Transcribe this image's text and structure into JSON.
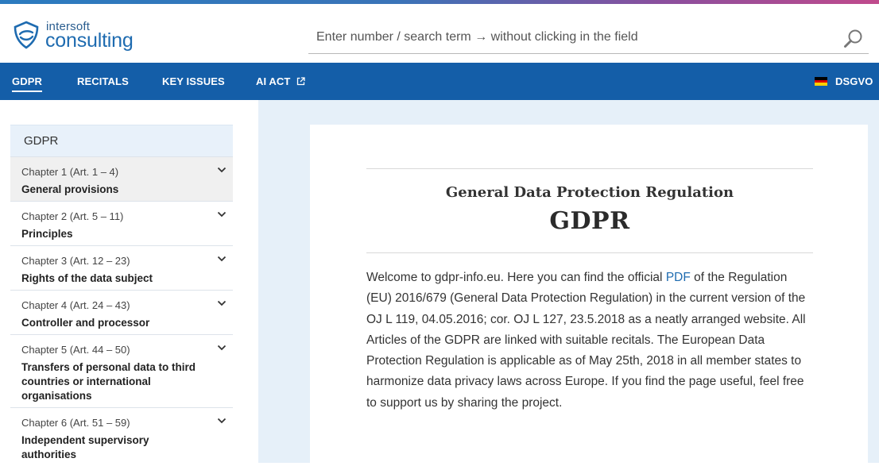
{
  "brand": {
    "line1": "intersoft",
    "line2": "consulting",
    "color": "#1e6bb0"
  },
  "search": {
    "placeholder": "Enter number / search term → without clicking in the field",
    "icon": "magnifier-icon"
  },
  "nav": {
    "items": [
      {
        "label": "GDPR",
        "active": true
      },
      {
        "label": "RECITALS"
      },
      {
        "label": "KEY ISSUES"
      },
      {
        "label": "AI ACT",
        "icon": "external-link-icon"
      }
    ],
    "lang_label": "DSGVO",
    "lang_icon": "german-flag-icon",
    "bg": "#145ea8"
  },
  "sidebar": {
    "heading": "GDPR",
    "chapters": [
      {
        "num": "Chapter 1 (Art. 1 – 4)",
        "title": "General provisions"
      },
      {
        "num": "Chapter 2 (Art. 5 – 11)",
        "title": "Principles"
      },
      {
        "num": "Chapter 3 (Art. 12 – 23)",
        "title": "Rights of the data subject"
      },
      {
        "num": "Chapter 4 (Art. 24 – 43)",
        "title": "Controller and processor"
      },
      {
        "num": "Chapter 5 (Art. 44 – 50)",
        "title": "Transfers of personal data to third countries or international organisations"
      },
      {
        "num": "Chapter 6 (Art. 51 – 59)",
        "title": "Independent supervisory authorities"
      }
    ]
  },
  "main": {
    "subtitle": "General Data Protection Regulation",
    "title": "GDPR",
    "intro_before": "Welcome to gdpr-info.eu. Here you can find the official ",
    "intro_link": "PDF",
    "intro_after": " of the Regulation (EU) 2016/679 (General Data Protection Regulation) in the current version of the OJ L 119, 04.05.2016; cor. OJ L 127, 23.5.2018 as a neatly arranged website. All Articles of the GDPR are linked with suitable recitals. The European Data Protection Regulation is applicable as of May 25th, 2018 in all member states to harmonize data privacy laws across Europe. If you find the page useful, feel free to support us by sharing the project."
  }
}
